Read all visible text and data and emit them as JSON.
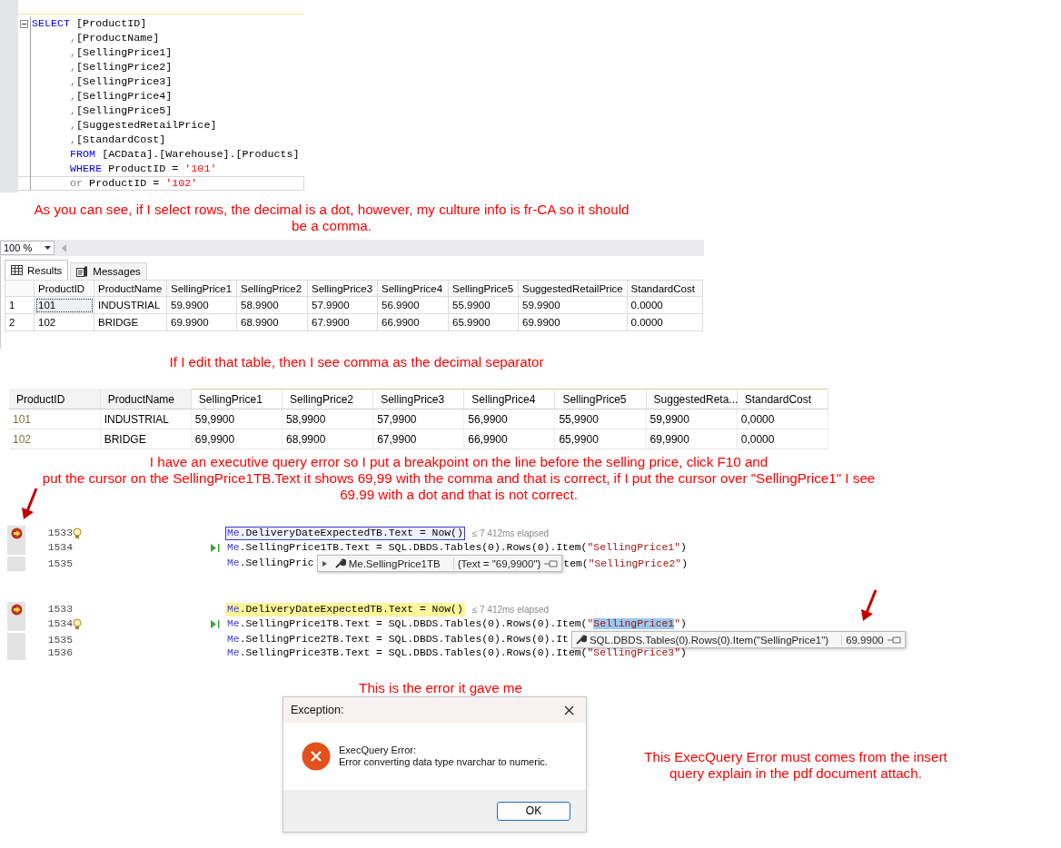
{
  "editor": {
    "lines": [
      {
        "collapsible": true,
        "cursor": false,
        "segments": [
          {
            "kind": "keyword",
            "text": "SELECT"
          },
          {
            "kind": "plain",
            "text": " [ProductID]"
          }
        ]
      },
      {
        "collapsible": false,
        "cursor": false,
        "segments": [
          {
            "kind": "operator",
            "text": "      ,"
          },
          {
            "kind": "plain",
            "text": "[ProductName]"
          }
        ]
      },
      {
        "collapsible": false,
        "cursor": false,
        "segments": [
          {
            "kind": "operator",
            "text": "      ,"
          },
          {
            "kind": "plain",
            "text": "[SellingPrice1]"
          }
        ]
      },
      {
        "collapsible": false,
        "cursor": false,
        "segments": [
          {
            "kind": "operator",
            "text": "      ,"
          },
          {
            "kind": "plain",
            "text": "[SellingPrice2]"
          }
        ]
      },
      {
        "collapsible": false,
        "cursor": false,
        "segments": [
          {
            "kind": "operator",
            "text": "      ,"
          },
          {
            "kind": "plain",
            "text": "[SellingPrice3]"
          }
        ]
      },
      {
        "collapsible": false,
        "cursor": false,
        "segments": [
          {
            "kind": "operator",
            "text": "      ,"
          },
          {
            "kind": "plain",
            "text": "[SellingPrice4]"
          }
        ]
      },
      {
        "collapsible": false,
        "cursor": false,
        "segments": [
          {
            "kind": "operator",
            "text": "      ,"
          },
          {
            "kind": "plain",
            "text": "[SellingPrice5]"
          }
        ]
      },
      {
        "collapsible": false,
        "cursor": false,
        "segments": [
          {
            "kind": "operator",
            "text": "      ,"
          },
          {
            "kind": "plain",
            "text": "[SuggestedRetailPrice]"
          }
        ]
      },
      {
        "collapsible": false,
        "cursor": false,
        "segments": [
          {
            "kind": "operator",
            "text": "      ,"
          },
          {
            "kind": "plain",
            "text": "[StandardCost]"
          }
        ]
      },
      {
        "collapsible": false,
        "cursor": false,
        "segments": [
          {
            "kind": "keyword",
            "text": "      FROM"
          },
          {
            "kind": "plain",
            "text": " [ACData].[Warehouse].[Products]"
          }
        ]
      },
      {
        "collapsible": false,
        "cursor": false,
        "segments": [
          {
            "kind": "keyword",
            "text": "      WHERE"
          },
          {
            "kind": "plain",
            "text": " ProductID = "
          },
          {
            "kind": "string",
            "text": "'101'"
          }
        ]
      },
      {
        "collapsible": false,
        "cursor": true,
        "segments": [
          {
            "kind": "operator",
            "text": "      or"
          },
          {
            "kind": "plain",
            "text": " ProductID = "
          },
          {
            "kind": "string",
            "text": "'102'"
          }
        ]
      }
    ]
  },
  "select_note": "As you can see, if I select rows, the decimal is a dot, however, my culture info is fr-CA so it should\nbe a comma.",
  "results": {
    "zoom": "100 %",
    "tabs": [
      {
        "label": "Results",
        "selected": true
      },
      {
        "label": "Messages",
        "selected": false
      }
    ],
    "columns": [
      "ProductID",
      "ProductName",
      "SellingPrice1",
      "SellingPrice2",
      "SellingPrice3",
      "SellingPrice4",
      "SellingPrice5",
      "SuggestedRetailPrice",
      "StandardCost"
    ],
    "rows": [
      {
        "number": "1",
        "cells": [
          {
            "text": "101",
            "selected": true
          },
          {
            "text": "INDUSTRIAL",
            "selected": false
          },
          {
            "text": "59.9900",
            "selected": false
          },
          {
            "text": "58.9900",
            "selected": false
          },
          {
            "text": "57.9900",
            "selected": false
          },
          {
            "text": "56.9900",
            "selected": false
          },
          {
            "text": "55.9900",
            "selected": false
          },
          {
            "text": "59.9900",
            "selected": false
          },
          {
            "text": "0.0000",
            "selected": false
          }
        ]
      },
      {
        "number": "2",
        "cells": [
          {
            "text": "102",
            "selected": false
          },
          {
            "text": "BRIDGE",
            "selected": false
          },
          {
            "text": "69.9900",
            "selected": false
          },
          {
            "text": "68.9900",
            "selected": false
          },
          {
            "text": "67.9900",
            "selected": false
          },
          {
            "text": "66.9900",
            "selected": false
          },
          {
            "text": "65.9900",
            "selected": false
          },
          {
            "text": "69.9900",
            "selected": false
          },
          {
            "text": "0.0000",
            "selected": false
          }
        ]
      }
    ]
  },
  "edit_note": "If I edit that table, then I see comma as the decimal separator",
  "edit_grid": {
    "columns": [
      "ProductID",
      "ProductName",
      "SellingPrice1",
      "SellingPrice2",
      "SellingPrice3",
      "SellingPrice4",
      "SellingPrice5",
      "SuggestedReta...",
      "StandardCost"
    ],
    "rows": [
      [
        "101",
        "INDUSTRIAL",
        "59,9900",
        "58,9900",
        "57,9900",
        "56,9900",
        "55,9900",
        "59,9900",
        "0,0000"
      ],
      [
        "102",
        "BRIDGE",
        "69,9900",
        "68,9900",
        "67,9900",
        "66,9900",
        "65,9900",
        "69,9900",
        "0,0000"
      ]
    ]
  },
  "debug_note": "I have an executive query error so I put a breakpoint on the line before the selling price, click F10 and\nput the cursor on the SellingPrice1TB.Text it shows 69,99 with the comma and that is correct, if I put the cursor over \"SellingPrice1\" I see\n69.99 with a dot and that is not correct.",
  "debuggers": [
    {
      "lines": [
        {
          "number": "1533",
          "outlined": true,
          "highlighted": false,
          "breakpoint_arrow": true,
          "bulb": true,
          "run_arrow": false,
          "segments": [
            {
              "kind": "me",
              "text": "Me"
            },
            {
              "kind": "plain",
              "text": ".DeliveryDateExpectedTB.Text = Now()"
            }
          ],
          "hint": "≤ 7 412ms elapsed"
        },
        {
          "number": "1534",
          "outlined": false,
          "highlighted": false,
          "breakpoint_arrow": false,
          "bulb": false,
          "run_arrow": true,
          "segments": [
            {
              "kind": "me",
              "text": "Me"
            },
            {
              "kind": "plain",
              "text": ".SellingPrice1TB.Text = SQL.DBDS.Tables(0).Rows(0).Item("
            },
            {
              "kind": "string",
              "text": "\"SellingPrice1\""
            },
            {
              "kind": "plain",
              "text": ")"
            }
          ]
        },
        {
          "number": "1535",
          "outlined": false,
          "highlighted": false,
          "breakpoint_arrow": false,
          "bulb": false,
          "run_arrow": false,
          "segments": [
            {
              "kind": "me",
              "text": "Me"
            },
            {
              "kind": "plain",
              "text": ".SellingPric"
            }
          ],
          "datatip": {
            "expandable": true,
            "name": "Me.SellingPrice1TB",
            "value": "{Text = \"69,9900\"}"
          },
          "tail": [
            {
              "kind": "plain",
              "text": "tem("
            },
            {
              "kind": "string",
              "text": "\"SellingPrice2\""
            },
            {
              "kind": "plain",
              "text": ")"
            }
          ]
        }
      ]
    },
    {
      "lines": [
        {
          "number": "1533",
          "outlined": false,
          "highlighted": true,
          "breakpoint_arrow": true,
          "bulb": false,
          "run_arrow": false,
          "segments": [
            {
              "kind": "me",
              "text": "Me"
            },
            {
              "kind": "plain",
              "text": ".DeliveryDateExpectedTB.Text = Now()"
            }
          ],
          "hint": "≤ 7 412ms elapsed"
        },
        {
          "number": "1534",
          "outlined": false,
          "highlighted": false,
          "breakpoint_arrow": false,
          "bulb": true,
          "run_arrow": true,
          "segments": [
            {
              "kind": "me",
              "text": "Me"
            },
            {
              "kind": "plain",
              "text": ".SellingPrice1TB.Text = SQL.DBDS.Tables(0).Rows(0).Item("
            },
            {
              "kind": "string",
              "text": "\""
            },
            {
              "kind": "selected",
              "text": "SellingPrice1"
            },
            {
              "kind": "string",
              "text": "\""
            },
            {
              "kind": "plain",
              "text": ")"
            }
          ]
        },
        {
          "number": "1535",
          "outlined": false,
          "highlighted": false,
          "breakpoint_arrow": false,
          "bulb": false,
          "run_arrow": false,
          "segments": [
            {
              "kind": "me",
              "text": "Me"
            },
            {
              "kind": "plain",
              "text": ".SellingPrice2TB.Text = SQL.DBDS.Tables(0).Rows(0).It"
            }
          ],
          "datatip": {
            "expandable": false,
            "name": "SQL.DBDS.Tables(0).Rows(0).Item(\"SellingPrice1\")",
            "value": "69.9900"
          }
        },
        {
          "number": "1536",
          "outlined": false,
          "highlighted": false,
          "breakpoint_arrow": false,
          "bulb": false,
          "run_arrow": false,
          "segments": [
            {
              "kind": "me",
              "text": "Me"
            },
            {
              "kind": "plain",
              "text": ".SellingPrice3TB.Text = SQL.DBDS.Tables(0).Rows(0).Item("
            },
            {
              "kind": "string",
              "text": "\"SellingPrice3\""
            },
            {
              "kind": "plain",
              "text": ")"
            }
          ]
        }
      ]
    }
  ],
  "error_note": "This is the error it gave me",
  "dialog": {
    "title": "Exception:",
    "heading": "ExecQuery Error:",
    "message": "Error converting data type nvarchar to numeric.",
    "button": "OK"
  },
  "cause_note": "This ExecQuery Error must comes from the insert\nquery explain in the pdf document attach."
}
